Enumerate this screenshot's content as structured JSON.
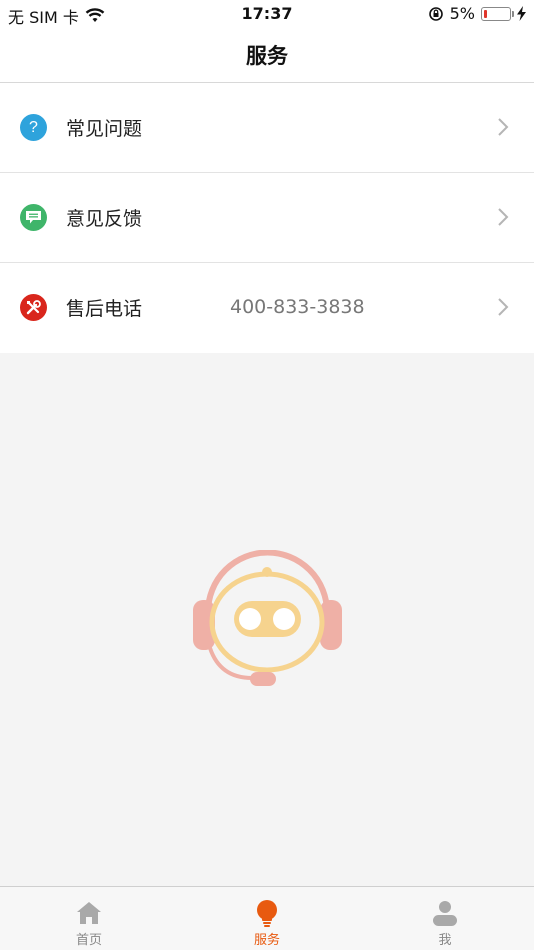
{
  "status_bar": {
    "carrier": "无 SIM 卡",
    "time": "17:37",
    "battery_percent": "5%"
  },
  "header": {
    "title": "服务"
  },
  "menu": {
    "items": [
      {
        "label": "常见问题",
        "value": "",
        "icon": "question-icon",
        "icon_color": "#2ea3dc"
      },
      {
        "label": "意见反馈",
        "value": "",
        "icon": "chat-icon",
        "icon_color": "#3fb56a"
      },
      {
        "label": "售后电话",
        "value": "400-833-3838",
        "icon": "tools-icon",
        "icon_color": "#d9261c"
      }
    ]
  },
  "illustration": {
    "icon": "support-robot-icon"
  },
  "tab_bar": {
    "tabs": [
      {
        "label": "首页",
        "icon": "home-icon",
        "active": false
      },
      {
        "label": "服务",
        "icon": "lightbulb-icon",
        "active": true
      },
      {
        "label": "我",
        "icon": "user-icon",
        "active": false
      }
    ],
    "active_color": "#e85a10",
    "inactive_color": "#888888"
  }
}
